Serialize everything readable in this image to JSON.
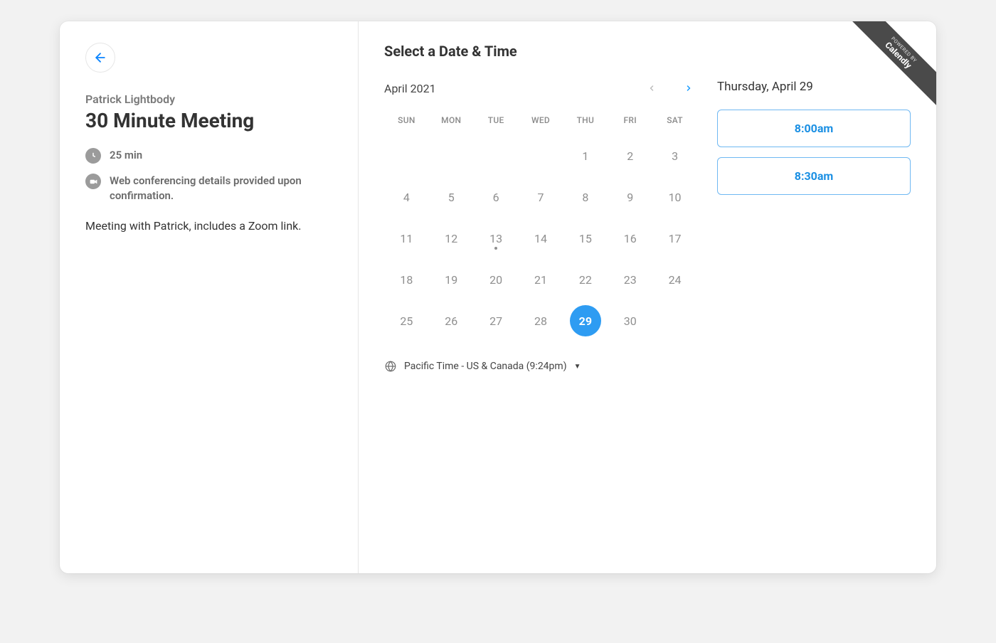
{
  "ribbon": {
    "powered_by": "POWERED BY",
    "brand": "Calendly"
  },
  "left": {
    "host_name": "Patrick Lightbody",
    "event_title": "30 Minute Meeting",
    "duration": "25 min",
    "location_text": "Web conferencing details provided upon confirmation.",
    "description": "Meeting with Patrick, includes a Zoom link."
  },
  "right": {
    "title": "Select a Date & Time",
    "month_label": "April 2021",
    "dow": [
      "SUN",
      "MON",
      "TUE",
      "WED",
      "THU",
      "FRI",
      "SAT"
    ],
    "weeks": [
      [
        "",
        "",
        "",
        "",
        "1",
        "2",
        "3"
      ],
      [
        "4",
        "5",
        "6",
        "7",
        "8",
        "9",
        "10"
      ],
      [
        "11",
        "12",
        "13",
        "14",
        "15",
        "16",
        "17"
      ],
      [
        "18",
        "19",
        "20",
        "21",
        "22",
        "23",
        "24"
      ],
      [
        "25",
        "26",
        "27",
        "28",
        "29",
        "30",
        ""
      ]
    ],
    "today_day": "13",
    "selected_day": "29",
    "timezone": "Pacific Time - US & Canada (9:24pm)",
    "selected_date_label": "Thursday, April 29",
    "slots": [
      "8:00am",
      "8:30am"
    ]
  }
}
